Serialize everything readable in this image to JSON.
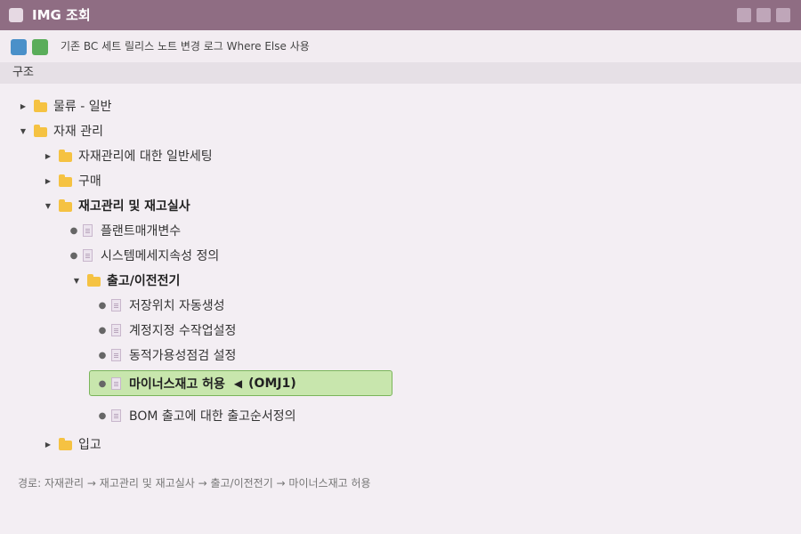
{
  "window": {
    "title": "IMG 조회"
  },
  "toolbar": {
    "text": "기존 BC 세트 릴리스 노트 변경 로그 Where Else 사용",
    "btn_colors": [
      "#4a90c9",
      "#5aad5a"
    ]
  },
  "section": {
    "label": "구조"
  },
  "tree": {
    "n1": "물류 - 일반",
    "n2": "자재 관리",
    "n3": "자재관리에 대한 일반세팅",
    "n4": "구매",
    "n5": "재고관리 및 재고실사",
    "n6": "플랜트매개변수",
    "n7": "시스템메세지속성 정의",
    "n8": "출고/이전전기",
    "n9": "저장위치 자동생성",
    "n10": "계정지정 수작업설정",
    "n11": "동적가용성점검 설정",
    "n12": "마이너스재고 허용",
    "n12_code": "(OMJ1)",
    "n13": "BOM 출고에 대한 출고순서정의",
    "n14": "입고"
  },
  "footer": {
    "path": "경로: 자재관리 → 재고관리 및 재고실사 → 출고/이전전기 → 마이너스재고 허용"
  }
}
